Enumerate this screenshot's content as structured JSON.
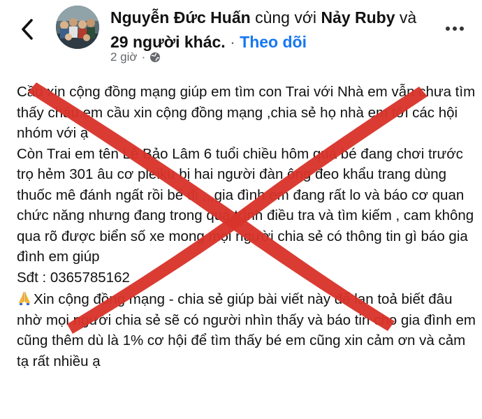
{
  "header": {
    "author_name": "Nguyễn Đức Huấn",
    "with_text": "cùng với",
    "tagged_name": "Nảy Ruby",
    "and_text": "và",
    "others_text": "29 người khác.",
    "dot": "·",
    "follow_label": "Theo dõi",
    "time": "2 giờ",
    "time_sep": "·",
    "back_icon": "chevron-left-icon",
    "more_icon": "more-dots-icon",
    "privacy_icon": "globe-icon"
  },
  "post": {
    "paragraph1": "Cầu xin cộng đồng mạng giúp em tìm con Trai với  Nhà em vẫn chưa tìm thấy cháu.em cầu xin cộng đồng mạng ,chia sẻ họ nhà em tới các hội nhóm với ạ\nCòn Trai em tên Lê Bảo Lâm 6 tuổi chiều hôm qua bé đang chơi trước trọ hẻm 301 âu cơ pleiku  bị hai người đàn ông đeo khẩu trang dùng thuốc mê đánh ngất rồi bế đi ,,,gia đình em đang rất lo và báo cơ quan chức năng nhưng đang trong quá trình điều tra và tìm kiếm , cam không qua rõ được biển số xe mong mọi người chia sẻ có thông tin gì báo gia đình em giúp\nSđt : 0365785162",
    "paragraph2": "Xin cộng đồng mạng - chia sẻ giúp bài viết này để lan toả biết đâu nhờ mọi người chia sẻ sẽ có người nhìn thấy và báo tin cho gia đình em cũng thêm dù là 1% cơ hội để tìm thấy bé em cũng xin cảm ơn và cảm tạ rất nhiều ạ",
    "paragraph2_icon": "praying-hands-icon"
  },
  "overlay": {
    "cross_color": "#d9342b",
    "cross_icon": "red-x-mark"
  },
  "colors": {
    "link_blue": "#1877f2",
    "meta_gray": "#65676b",
    "text": "#111111"
  }
}
